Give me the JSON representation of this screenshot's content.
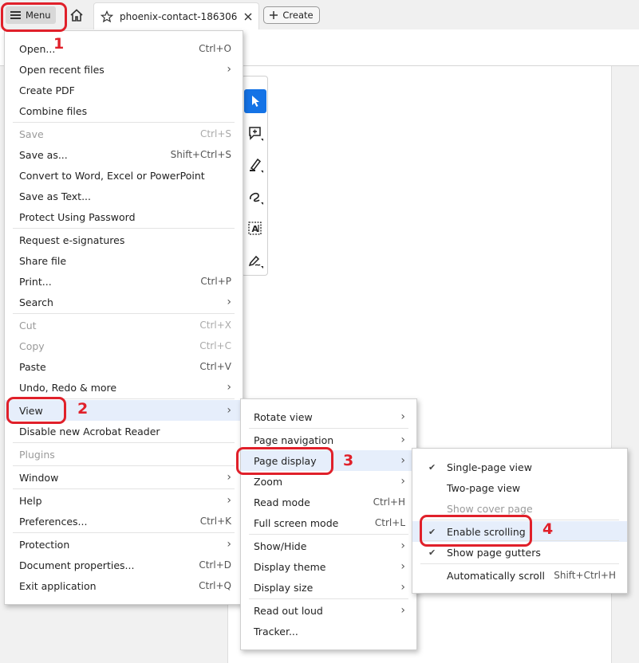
{
  "header": {
    "menu_label": "Menu",
    "tab_title": "phoenix-contact-186306...",
    "create_label": "Create"
  },
  "tools": [
    "select-icon",
    "add-comment-icon",
    "highlight-icon",
    "draw-icon",
    "text-field-icon",
    "sign-icon"
  ],
  "main_menu": {
    "items": [
      {
        "label": "Open...",
        "shortcut": "Ctrl+O"
      },
      {
        "label": "Open recent files",
        "submenu": true
      },
      {
        "label": "Create PDF"
      },
      {
        "label": "Combine files"
      },
      {
        "label": "Save",
        "shortcut": "Ctrl+S",
        "disabled": true
      },
      {
        "label": "Save as...",
        "shortcut": "Shift+Ctrl+S"
      },
      {
        "label": "Convert to Word, Excel or PowerPoint"
      },
      {
        "label": "Save as Text..."
      },
      {
        "label": "Protect Using Password"
      },
      {
        "label": "Request e-signatures"
      },
      {
        "label": "Share file"
      },
      {
        "label": "Print...",
        "shortcut": "Ctrl+P"
      },
      {
        "label": "Search",
        "submenu": true
      },
      {
        "label": "Cut",
        "shortcut": "Ctrl+X",
        "disabled": true
      },
      {
        "label": "Copy",
        "shortcut": "Ctrl+C",
        "disabled": true
      },
      {
        "label": "Paste",
        "shortcut": "Ctrl+V"
      },
      {
        "label": "Undo, Redo & more",
        "submenu": true
      },
      {
        "label": "View",
        "submenu": true,
        "highlighted": true
      },
      {
        "label": "Disable new Acrobat Reader"
      },
      {
        "label": "Plugins",
        "disabled": true
      },
      {
        "label": "Window",
        "submenu": true
      },
      {
        "label": "Help",
        "submenu": true
      },
      {
        "label": "Preferences...",
        "shortcut": "Ctrl+K"
      },
      {
        "label": "Protection",
        "submenu": true
      },
      {
        "label": "Document properties...",
        "shortcut": "Ctrl+D"
      },
      {
        "label": "Exit application",
        "shortcut": "Ctrl+Q"
      }
    ]
  },
  "view_menu": {
    "items": [
      {
        "label": "Rotate view",
        "submenu": true
      },
      {
        "label": "Page navigation",
        "submenu": true
      },
      {
        "label": "Page display",
        "submenu": true,
        "highlighted": true
      },
      {
        "label": "Zoom",
        "submenu": true
      },
      {
        "label": "Read mode",
        "shortcut": "Ctrl+H"
      },
      {
        "label": "Full screen mode",
        "shortcut": "Ctrl+L"
      },
      {
        "label": "Show/Hide",
        "submenu": true
      },
      {
        "label": "Display theme",
        "submenu": true
      },
      {
        "label": "Display size",
        "submenu": true
      },
      {
        "label": "Read out loud",
        "submenu": true
      },
      {
        "label": "Tracker..."
      }
    ]
  },
  "page_display_menu": {
    "items": [
      {
        "label": "Single-page view",
        "checked": true
      },
      {
        "label": "Two-page view"
      },
      {
        "label": "Show cover page",
        "disabled": true
      },
      {
        "label": "Enable scrolling",
        "checked": true,
        "highlighted": true
      },
      {
        "label": "Show page gutters",
        "checked": true
      },
      {
        "label": "Automatically scroll",
        "shortcut": "Shift+Ctrl+H"
      }
    ]
  },
  "annotations": [
    "1",
    "2",
    "3",
    "4"
  ],
  "colors": {
    "accent": "#1473e6",
    "annotation": "#e0202a",
    "highlight": "#e6eefb"
  }
}
